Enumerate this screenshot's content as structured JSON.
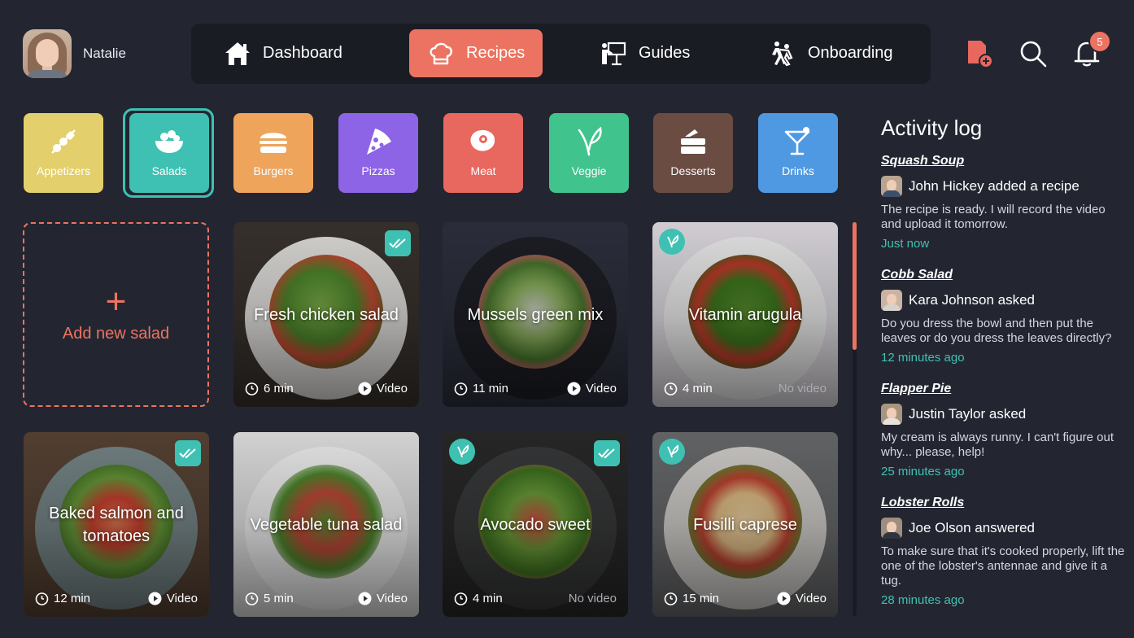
{
  "user": {
    "name": "Natalie"
  },
  "nav": [
    {
      "label": "Dashboard",
      "icon": "home-icon"
    },
    {
      "label": "Recipes",
      "icon": "chef-hat-icon",
      "active": true
    },
    {
      "label": "Guides",
      "icon": "presenter-icon"
    },
    {
      "label": "Onboarding",
      "icon": "walk-help-icon"
    }
  ],
  "header": {
    "notifications_count": "5"
  },
  "categories": [
    {
      "label": "Appetizers",
      "color": "#e3cf6b"
    },
    {
      "label": "Salads",
      "color": "#3ec1b2",
      "active": true
    },
    {
      "label": "Burgers",
      "color": "#eea45b"
    },
    {
      "label": "Pizzas",
      "color": "#8c64e5"
    },
    {
      "label": "Meat",
      "color": "#e8675f"
    },
    {
      "label": "Veggie",
      "color": "#41c38d"
    },
    {
      "label": "Desserts",
      "color": "#6b4c43"
    },
    {
      "label": "Drinks",
      "color": "#4f99e3"
    }
  ],
  "add_new": {
    "label": "Add new salad"
  },
  "recipes": [
    {
      "title": "Fresh chicken salad",
      "time": "6 min",
      "video": "Video",
      "checked": true,
      "veggie": false
    },
    {
      "title": "Mussels green mix",
      "time": "11 min",
      "video": "Video",
      "checked": false,
      "veggie": false
    },
    {
      "title": "Vitamin arugula",
      "time": "4 min",
      "video": "No video",
      "checked": false,
      "veggie": true
    },
    {
      "title": "Baked salmon and tomatoes",
      "time": "12 min",
      "video": "Video",
      "checked": true,
      "veggie": false
    },
    {
      "title": "Vegetable tuna salad",
      "time": "5 min",
      "video": "Video",
      "checked": false,
      "veggie": false
    },
    {
      "title": "Avocado sweet",
      "time": "4 min",
      "video": "No video",
      "checked": true,
      "veggie": true
    },
    {
      "title": "Fusilli caprese",
      "time": "15 min",
      "video": "Video",
      "checked": false,
      "veggie": true
    }
  ],
  "activity": {
    "title": "Activity log",
    "entries": [
      {
        "recipe": "Squash Soup",
        "who": "John Hickey added a recipe",
        "message": "The recipe is ready. I will record the video and upload it tomorrow.",
        "when": "Just now"
      },
      {
        "recipe": "Cobb Salad",
        "who": "Kara Johnson asked",
        "message": "Do you dress the bowl and then put the leaves or do you dress the leaves directly?",
        "when": "12 minutes ago"
      },
      {
        "recipe": "Flapper Pie",
        "who": "Justin Taylor asked",
        "message": "My cream is always runny. I can't figure out why... please, help!",
        "when": "25 minutes ago"
      },
      {
        "recipe": "Lobster Rolls",
        "who": "Joe Olson answered",
        "message": "To make sure that it's cooked properly, lift the one of the lobster's antennae and give it a tug.",
        "when": "28 minutes ago"
      }
    ]
  }
}
